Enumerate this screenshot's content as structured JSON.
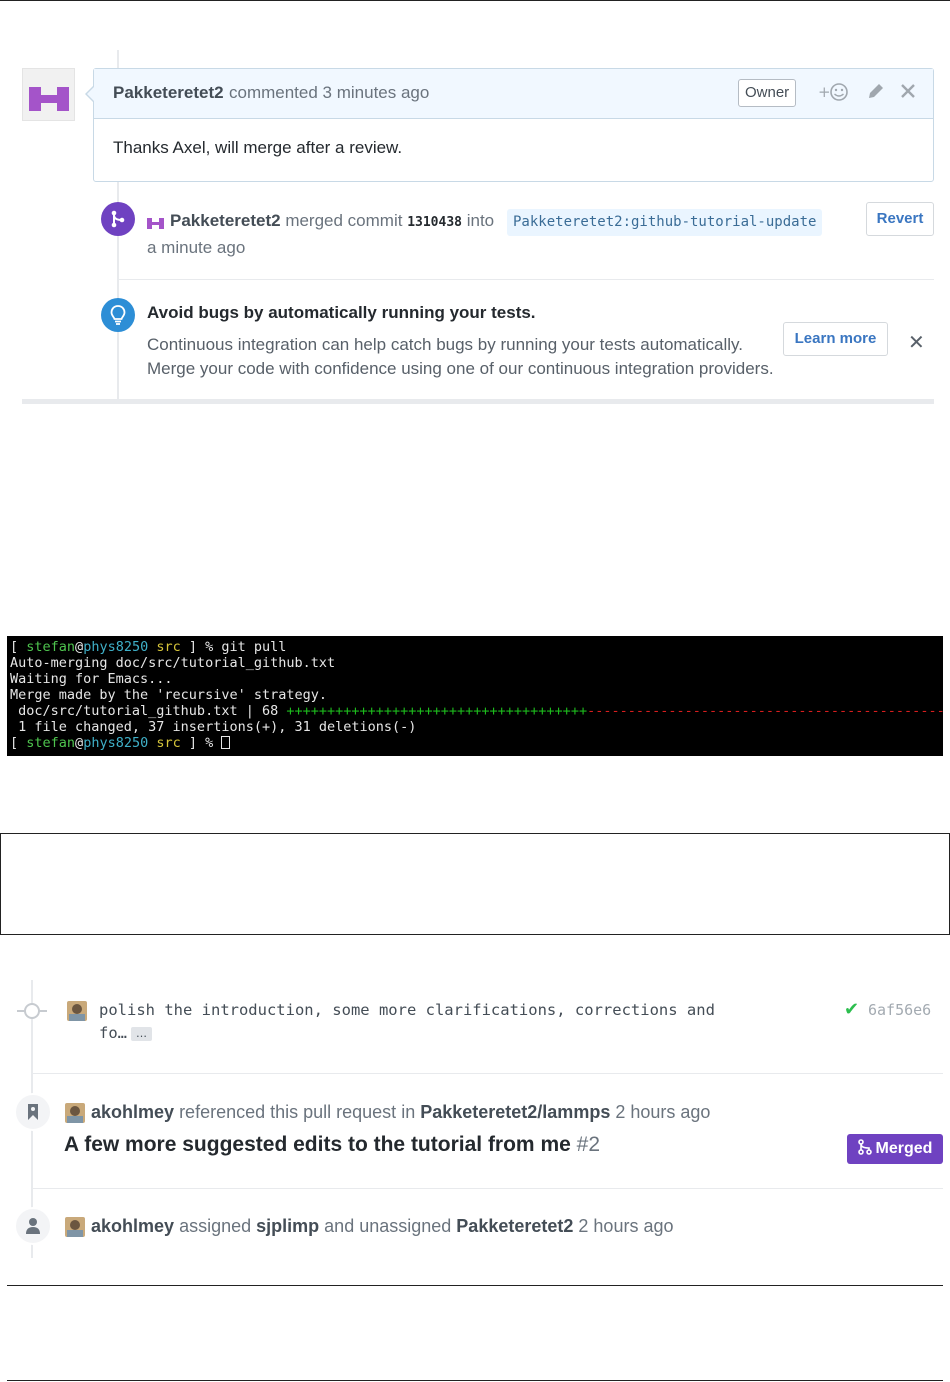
{
  "pr_comment": {
    "author": "Pakketeretet2",
    "meta": "commented 3 minutes ago",
    "badge": "Owner",
    "body": "Thanks Axel, will merge after a review.",
    "icons": [
      "add-reaction-icon",
      "pencil-icon",
      "close-icon"
    ]
  },
  "merge_event": {
    "user": "Pakketeretet2",
    "action": "merged commit",
    "sha": "1310438",
    "into": "into",
    "branch": "Pakketeretet2:github-tutorial-update",
    "time": "a minute ago",
    "revert_label": "Revert"
  },
  "ci_tip": {
    "title": "Avoid bugs by automatically running your tests.",
    "line1": "Continuous integration can help catch bugs by running your tests automatically.",
    "line2": "Merge your code with confidence using one of our continuous integration providers.",
    "learn_more_label": "Learn more",
    "dismiss": "✕"
  },
  "terminal": {
    "line0_user": "stefan",
    "line0_host": "phys8250",
    "line0_dir": "src",
    "line0_cmd": " ] % git pull",
    "line1": "Auto-merging doc/src/tutorial_github.txt",
    "line2": "Waiting for Emacs...",
    "line3": "Merge made by the 'recursive' strategy.",
    "line4_file": " doc/src/tutorial_github.txt | 68 ",
    "line4_plus": "+++++++++++++++++++++++++++++++++++++",
    "line4_minus": "------------------------------------------------------------------------",
    "line5": " 1 file changed, 37 insertions(+), 31 deletions(-)",
    "line6_user": "stefan",
    "line6_host": "phys8250",
    "line6_dir": "src",
    "line6_cmd": " ] % "
  },
  "commit": {
    "message": "polish the introduction, some more clarifications, corrections and fo…",
    "ellipsis": "…",
    "sha": "6af56e6",
    "status": "✔"
  },
  "reference_event": {
    "user": "akohlmey",
    "text": "referenced this pull request in",
    "repo": "Pakketeretet2/lammps",
    "time": "2 hours ago",
    "pr_title": "A few more suggested edits to the tutorial from me",
    "pr_number": "#2",
    "state": "Merged"
  },
  "assign_event": {
    "user": "akohlmey",
    "text1": "assigned",
    "assignee": "sjplimp",
    "text2": "and unassigned",
    "unassigned": "Pakketeretet2",
    "time": "2 hours ago"
  }
}
